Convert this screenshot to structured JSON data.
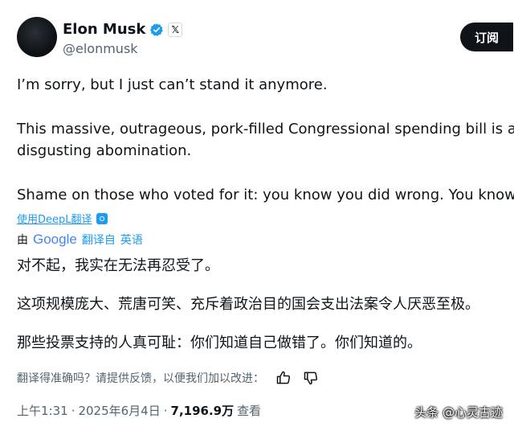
{
  "author": {
    "name": "Elon Musk",
    "handle": "@elonmusk",
    "x_badge": "𝕏"
  },
  "subscribe_label": "订阅",
  "tweet": {
    "line1": "I’m sorry, but I just can’t stand it anymore.",
    "line2a": "This massive, outrageous, pork-filled Congressional spending bill is a",
    "line2b": "disgusting abomination.",
    "line3": "Shame on those who voted for it: you know you did wrong. You know"
  },
  "deepl_label": "使用DeepL翻译",
  "google": {
    "by": "由",
    "brand": "Google",
    "translated_from": "翻译自",
    "language": "英语"
  },
  "translation": {
    "line1": "对不起，我实在无法再忍受了。",
    "line2": "这项规模庞大、荒唐可笑、充斥着政治目的国会支出法案令人厌恶至极。",
    "line3": "那些投票支持的人真可耻：你们知道自己做错了。你们知道的。"
  },
  "feedback_prompt": "翻译得准确吗？请提供反馈，以便我们加以改进：",
  "meta": {
    "time": "上午1:31",
    "dot1": "·",
    "date": "2025年6月4日",
    "dot2": "·",
    "views": "7,196.9万",
    "views_label": "查看"
  },
  "watermark": "头条 @心灵古迹",
  "colors": {
    "accent": "#1d9bf0",
    "text": "#0f1419",
    "muted": "#536471"
  },
  "icons": [
    "verified-badge-icon",
    "x-logo-icon",
    "deepl-icon",
    "thumbs-up-icon",
    "thumbs-down-icon"
  ]
}
